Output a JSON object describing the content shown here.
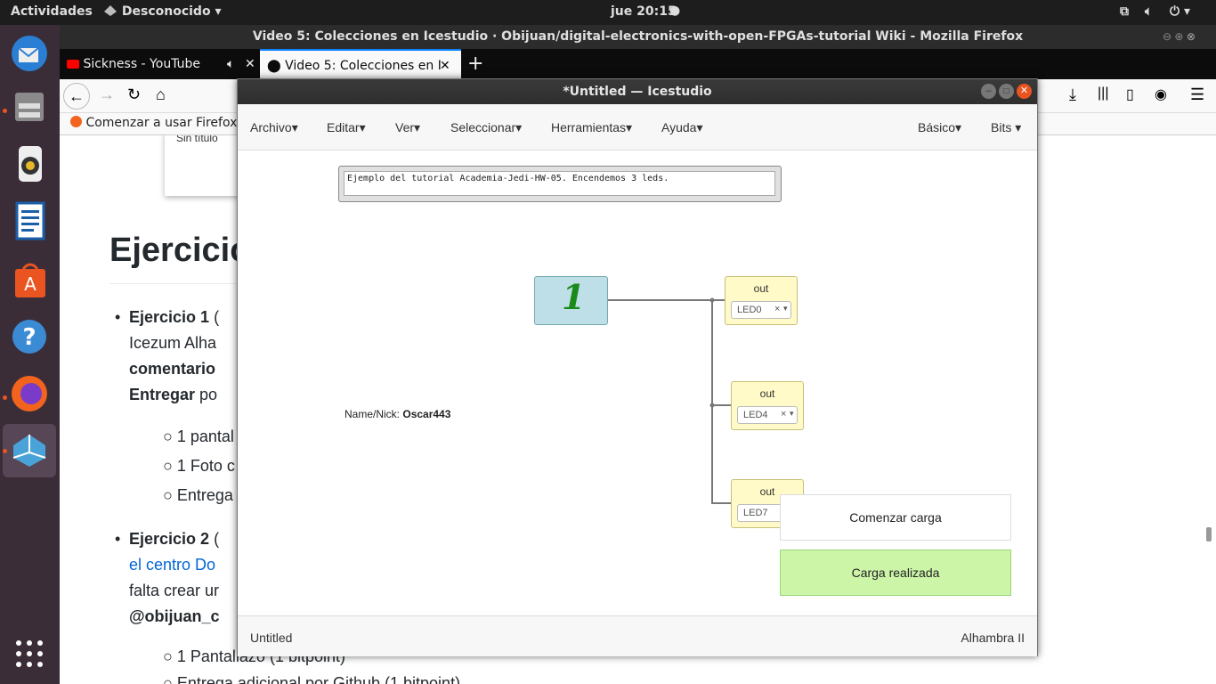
{
  "topbar": {
    "activities": "Actividades",
    "network": "Desconocido",
    "clock": "jue 20:15"
  },
  "firefox": {
    "window_title": "Video 5: Colecciones en Icestudio · Obijuan/digital-electronics-with-open-FPGAs-tutorial Wiki - Mozilla Firefox",
    "tabs": [
      {
        "label": "Sickness - YouTube"
      },
      {
        "label": "Video 5: Colecciones en I"
      }
    ],
    "bookmark": "Comenzar a usar Firefox",
    "popup_text": "Sin título"
  },
  "page": {
    "heading": "Ejercicio",
    "list": [
      {
        "bold": "Ejercicio 1",
        "rest": " (",
        "line2": "Icezum Alha",
        "line3": "comentario",
        "line4a": "Entregar",
        "line4b": " po"
      },
      {
        "bold": "Ejercicio 2",
        "rest": " (",
        "link": "el centro Do",
        "line3": "falta crear ur",
        "line4": "@obijuan_c"
      }
    ],
    "sub1": [
      "1 pantal",
      "1 Foto c",
      "Entrega"
    ],
    "sub2": [
      "1 Pantallazo (1 bitpoint)",
      "Entrega adicional por Github (1 bitpoint)"
    ]
  },
  "icestudio": {
    "title": "*Untitled — Icestudio",
    "menu": [
      "Archivo",
      "Editar",
      "Ver",
      "Seleccionar",
      "Herramientas",
      "Ayuda"
    ],
    "menu_right": [
      "Básico",
      "Bits"
    ],
    "comment": "Ejemplo del tutorial Academia-Jedi-HW-05. Encendemos 3 leds.",
    "name_label": "Name/Nick:",
    "name_value": "Oscar443",
    "const_value": "1",
    "outs": [
      {
        "title": "out",
        "pin": "LED0"
      },
      {
        "title": "out",
        "pin": "LED4"
      },
      {
        "title": "out",
        "pin": "LED7"
      }
    ],
    "load_start": "Comenzar carga",
    "load_done": "Carga realizada",
    "footer_left": "Untitled",
    "footer_right": "Alhambra II",
    "colors": {
      "load_done_bg": "#ccf5a8",
      "const_bg": "#bfdfe8",
      "out_bg": "#fffac7"
    }
  }
}
